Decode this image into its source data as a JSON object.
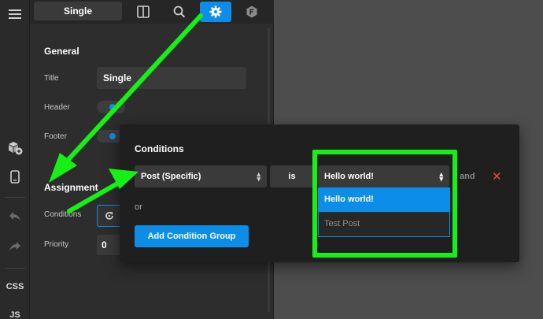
{
  "topbar": {
    "template_tab": "Single",
    "icons": [
      "layout-icon",
      "search-icon",
      "gear-icon",
      "template-icon"
    ]
  },
  "rail": {
    "css_label": "CSS",
    "js_label": "JS"
  },
  "settings": {
    "general_heading": "General",
    "title_label": "Title",
    "title_value": "Single",
    "header_label": "Header",
    "footer_label": "Footer",
    "assignment_heading": "Assignment",
    "conditions_label": "Conditions",
    "priority_label": "Priority",
    "priority_value": "0"
  },
  "modal": {
    "title": "Conditions",
    "condition": {
      "type": "Post (Specific)",
      "operator": "is",
      "value": "Hello world!"
    },
    "and_label": "and",
    "or_label": "or",
    "add_group_label": "Add Condition Group",
    "dropdown_options": [
      "Hello world!",
      "Test Post"
    ]
  },
  "colors": {
    "accent": "#0c8ee8",
    "annotation": "#16f016",
    "remove": "#e14b4b"
  }
}
